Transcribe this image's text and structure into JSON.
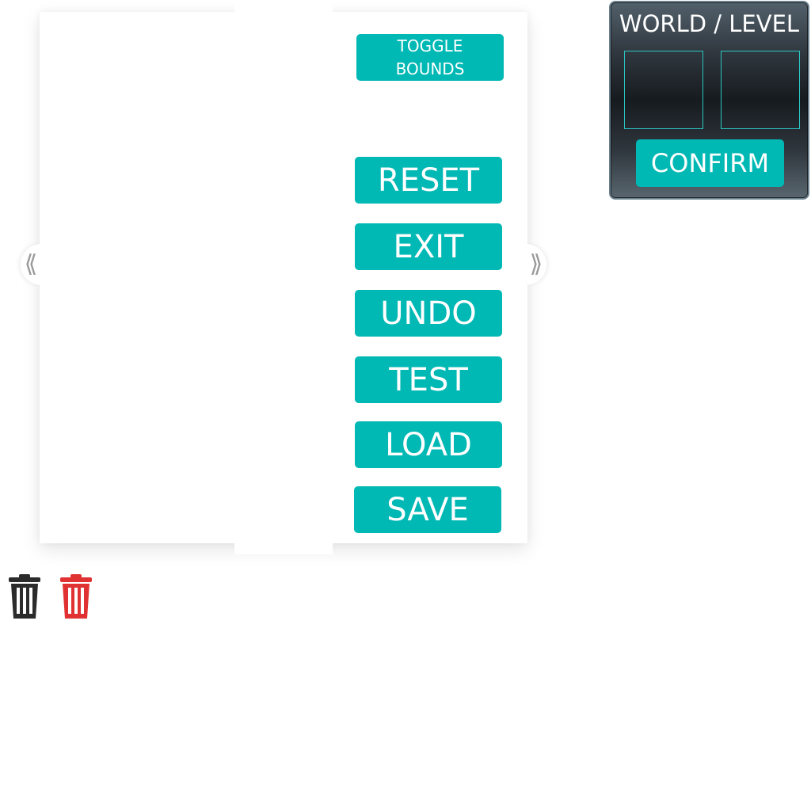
{
  "editor": {
    "toggle_bounds_line1": "TOGGLE",
    "toggle_bounds_line2": "BOUNDS",
    "reset_label": "RESET",
    "exit_label": "EXIT",
    "undo_label": "UNDO",
    "test_label": "TEST",
    "load_label": "LOAD",
    "save_label": "SAVE",
    "prev_arrow": "⟪",
    "next_arrow": "⟫"
  },
  "level_select": {
    "title": "WORLD / LEVEL",
    "confirm_label": "CONFIRM"
  },
  "icons": {
    "trash_dark": "trash-icon",
    "trash_red": "trash-icon",
    "trash_dark_color": "#2b2b2b",
    "trash_red_color": "#e03232"
  },
  "colors": {
    "accent": "#00b8b4",
    "slot_border": "#29c6c3"
  }
}
